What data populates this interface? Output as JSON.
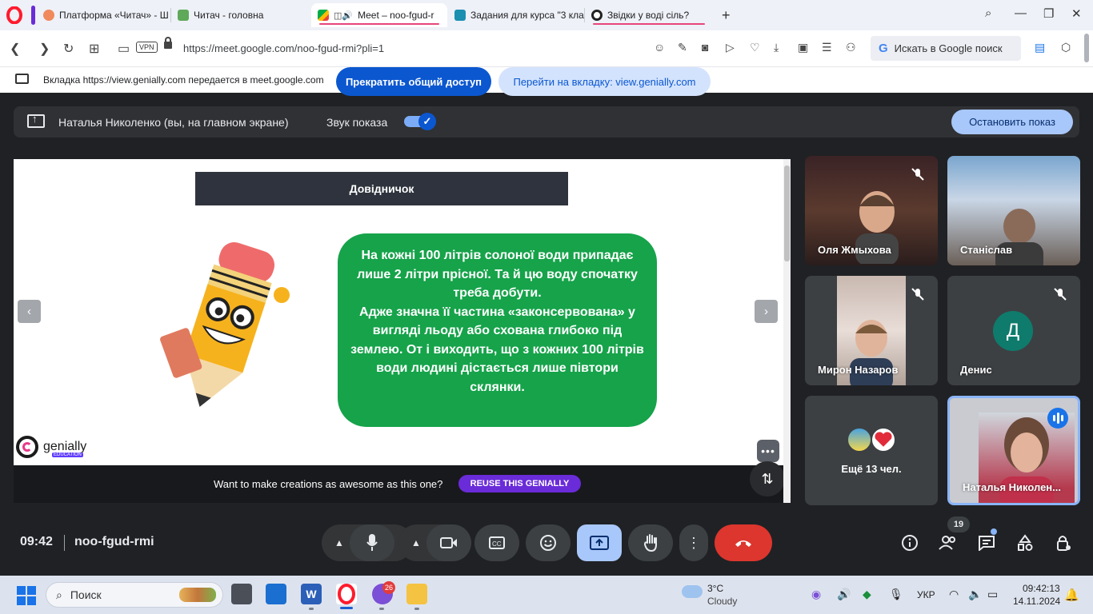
{
  "browser": {
    "tabs": [
      {
        "title": "Платформа «Читач» - Ш",
        "active": false
      },
      {
        "title": "Читач - головна",
        "active": false
      },
      {
        "title": "Meet – noo-fgud-r",
        "active": true
      },
      {
        "title": "Задания для курса \"3 кла",
        "active": false
      },
      {
        "title": "Звідки у воді сіль?",
        "active": false
      }
    ],
    "new_tab": "+",
    "vpn_label": "VPN",
    "url": "https://meet.google.com/noo-fgud-rmi?pli=1",
    "search_placeholder": "Искать в Google поиск",
    "search_g": "G"
  },
  "share_bar": {
    "info_text": "Вкладка https://view.genially.com передается в meet.google.com",
    "stop_button": "Прекратить общий доступ",
    "goto_button": "Перейти на вкладку: view.genially.com"
  },
  "presenting_bar": {
    "presenter": "Наталья Николенко (вы, на главном экране)",
    "sound_label": "Звук показа",
    "sound_on": true,
    "stop_button": "Остановить показ"
  },
  "slide": {
    "title": "Довідничок",
    "paragraphs": [
      "На кожні 100 літрів солоної води припадає лише 2 літри прісної. Та й цю воду спочатку треба добути.",
      "Адже значна її частина «законсервована» у вигляді льоду або схована глибоко під землею. От і виходить, що з кожних 100 літрів води людині дістається лише півтори склянки."
    ],
    "brand": "genially",
    "brand_tag": "EDUCATION",
    "cta_text": "Want to make creations as awesome as this one?",
    "cta_button": "REUSE THIS GENIALLY",
    "prev_arrow": "‹",
    "next_arrow": "›",
    "more": "•••"
  },
  "participants": [
    {
      "name": "Оля Жмыхова",
      "muted": true
    },
    {
      "name": "Станіслав",
      "muted": false
    },
    {
      "name": "Мирон Назаров",
      "muted": true
    },
    {
      "name": "Денис",
      "muted": true,
      "avatar_letter": "Д"
    },
    {
      "name": "Ещё 13 чел."
    },
    {
      "name": "Наталья Николен...",
      "speaking": true
    }
  ],
  "controls": {
    "time": "09:42",
    "meeting_code": "noo-fgud-rmi",
    "people_count": "19"
  },
  "taskbar": {
    "search_placeholder": "Поиск",
    "viber_badge": "26",
    "weather_temp": "3°C",
    "weather_desc": "Cloudy",
    "language": "УКР",
    "time": "09:42:13",
    "date": "14.11.2024"
  },
  "colors": {
    "meet_bg": "#202124",
    "slide_green": "#16a34a",
    "hangup_red": "#dc362e",
    "accent_blue": "#0b57d0",
    "genially_purple": "#6a2bd9"
  }
}
